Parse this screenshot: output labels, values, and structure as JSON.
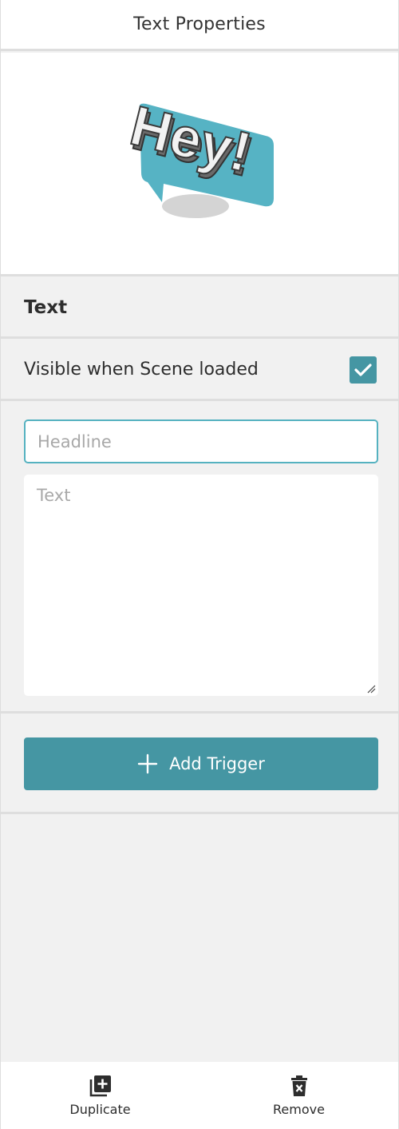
{
  "header": {
    "title": "Text Properties"
  },
  "preview": {
    "image_text": "Hey!",
    "accent_color": "#56b3c4"
  },
  "section": {
    "title": "Text"
  },
  "visibility": {
    "label": "Visible when Scene loaded",
    "checked": true,
    "checkbox_color": "#4596a3"
  },
  "fields": {
    "headline": {
      "placeholder": "Headline",
      "value": ""
    },
    "text": {
      "placeholder": "Text",
      "value": ""
    }
  },
  "trigger": {
    "label": "Add Trigger",
    "icon": "plus-icon",
    "button_color": "#4596a3"
  },
  "footer": {
    "duplicate": {
      "label": "Duplicate",
      "icon": "duplicate-icon"
    },
    "remove": {
      "label": "Remove",
      "icon": "trash-icon"
    }
  }
}
